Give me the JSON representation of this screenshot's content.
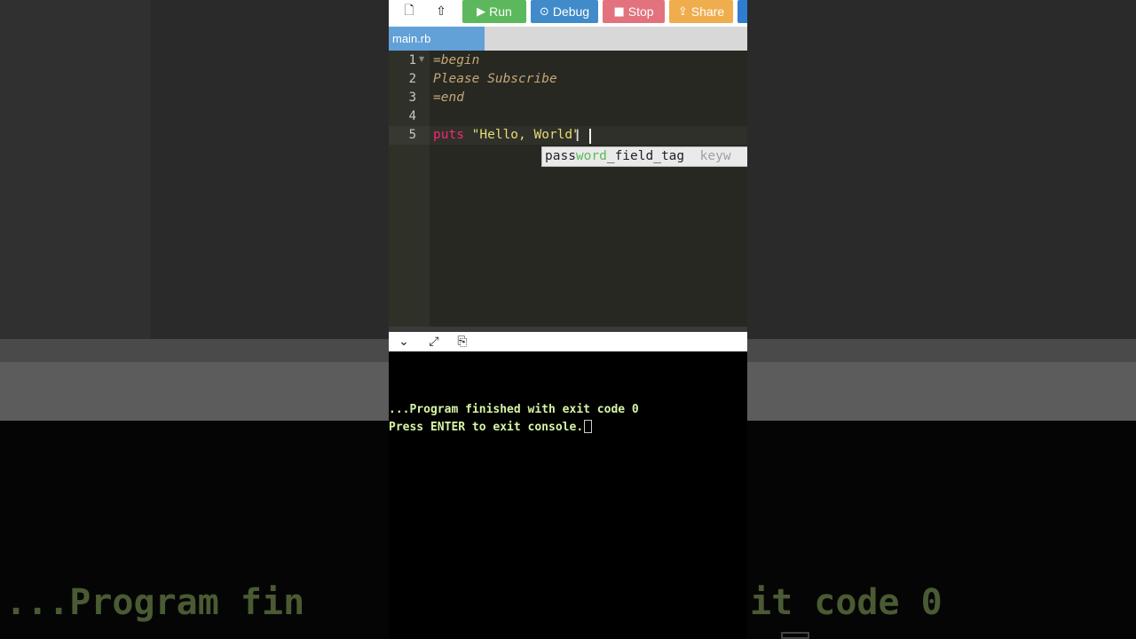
{
  "toolbar": {
    "new_file_icon": "file-icon",
    "upload_icon": "upload-icon",
    "run_label": "Run",
    "run_glyph": "▶",
    "debug_label": "Debug",
    "debug_glyph": "⊙",
    "stop_label": "Stop",
    "stop_glyph": "■",
    "share_label": "Share",
    "share_glyph": "⇪"
  },
  "tab": {
    "filename": "main.rb"
  },
  "editor": {
    "lines": [
      {
        "number": "1",
        "text": "=begin"
      },
      {
        "number": "2",
        "text": "Please Subscribe"
      },
      {
        "number": "3",
        "text": "=end"
      },
      {
        "number": "4",
        "text": ""
      },
      {
        "number": "5",
        "keyword": "puts",
        "string": "\"Hello, World\""
      }
    ],
    "autocomplete": {
      "match": "pass",
      "highlight": "word",
      "rest": "_field_tag",
      "meta": "keyw"
    }
  },
  "console": {
    "line1": "...Program finished with exit code 0",
    "line2": "Press ENTER to exit console."
  },
  "background": {
    "text_left": "...Program fin",
    "text_right": "it code 0"
  },
  "colors": {
    "run": "#5cb85c",
    "debug": "#428bca",
    "stop": "#e2737e",
    "share": "#f0ad4e",
    "tab": "#62a0d8",
    "console_text": "#d7f5a6"
  }
}
